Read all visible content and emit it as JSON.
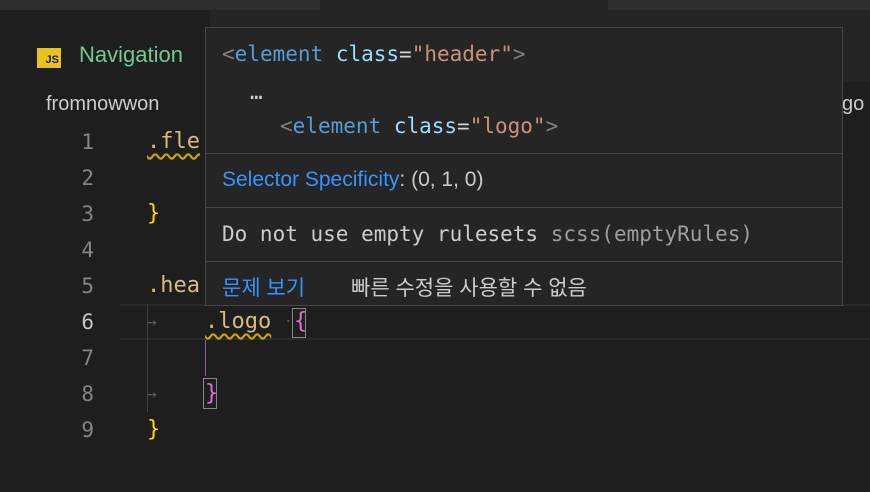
{
  "tab": {
    "badge": "JS",
    "label": "Navigation"
  },
  "breadcrumbs": {
    "left": "fromnowwon",
    "right": "go"
  },
  "lines": [
    {
      "n": "1",
      "text": ".fle"
    },
    {
      "n": "2",
      "text": ""
    },
    {
      "n": "3",
      "text": "}"
    },
    {
      "n": "4",
      "text": ""
    },
    {
      "n": "5",
      "text": ".hea"
    },
    {
      "n": "6",
      "selector": ".logo",
      "brace": "{"
    },
    {
      "n": "7",
      "text": ""
    },
    {
      "n": "8",
      "brace": "}"
    },
    {
      "n": "9",
      "text": "}"
    }
  ],
  "hover": {
    "outer": {
      "lt": "<",
      "tag": "element",
      "attr": "class",
      "eq": "=",
      "val": "\"header\"",
      "gt": ">"
    },
    "ellipsis": "…",
    "inner": {
      "lt": "<",
      "tag": "element",
      "attr": "class",
      "eq": "=",
      "val": "\"logo\"",
      "gt": ">"
    },
    "specificity_label": "Selector Specificity",
    "specificity_value": ": (0, 1, 0)",
    "diagnostic": "Do not use empty rulesets",
    "diagnostic_source": "scss(emptyRules)",
    "view_problem": "문제 보기",
    "no_quick_fix": "빠른 수정을 사용할 수 없음"
  }
}
